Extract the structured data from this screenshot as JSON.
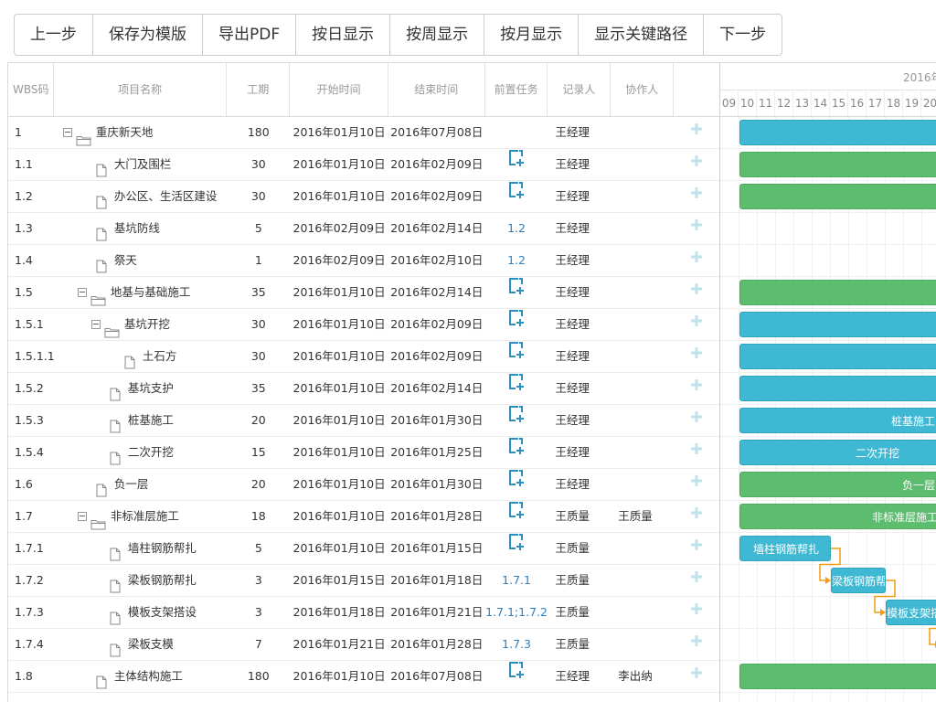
{
  "toolbar": {
    "prev": "上一步",
    "save_template": "保存为模版",
    "export_pdf": "导出PDF",
    "by_day": "按日显示",
    "by_week": "按周显示",
    "by_month": "按月显示",
    "critical_path": "显示关键路径",
    "next": "下一步"
  },
  "columns": {
    "wbs": "WBS码",
    "name": "项目名称",
    "duration": "工期",
    "start": "开始时间",
    "end": "结束时间",
    "predecessor": "前置任务",
    "recorder": "记录人",
    "collaborator": "协作人"
  },
  "gantt": {
    "month_label": "2016年",
    "days": [
      "09",
      "10",
      "11",
      "12",
      "13",
      "14",
      "15",
      "16",
      "17",
      "18",
      "19",
      "20"
    ]
  },
  "colors": {
    "blue_bar": "#3fb8d4",
    "green_bar": "#5cbd6e",
    "link": "#f39c12",
    "accent": "#2f7fc1"
  },
  "rows": [
    {
      "wbs": "1",
      "name": "重庆新天地",
      "level": 0,
      "type": "folder",
      "duration": "180",
      "start": "2016年01月10日",
      "end": "2016年07月08日",
      "pred": "",
      "pred_icon": false,
      "recorder": "王经理",
      "collab": "",
      "bar": "blue",
      "bar_label": ""
    },
    {
      "wbs": "1.1",
      "name": "大门及围栏",
      "level": 1,
      "type": "file",
      "duration": "30",
      "start": "2016年01月10日",
      "end": "2016年02月09日",
      "pred": "",
      "pred_icon": true,
      "recorder": "王经理",
      "collab": "",
      "bar": "green",
      "bar_label": ""
    },
    {
      "wbs": "1.2",
      "name": "办公区、生活区建设",
      "level": 1,
      "type": "file",
      "duration": "30",
      "start": "2016年01月10日",
      "end": "2016年02月09日",
      "pred": "",
      "pred_icon": true,
      "recorder": "王经理",
      "collab": "",
      "bar": "green",
      "bar_label": ""
    },
    {
      "wbs": "1.3",
      "name": "基坑防线",
      "level": 1,
      "type": "file",
      "duration": "5",
      "start": "2016年02月09日",
      "end": "2016年02月14日",
      "pred": "1.2",
      "pred_icon": false,
      "recorder": "王经理",
      "collab": "",
      "bar": "",
      "bar_label": ""
    },
    {
      "wbs": "1.4",
      "name": "祭天",
      "level": 1,
      "type": "file",
      "duration": "1",
      "start": "2016年02月09日",
      "end": "2016年02月10日",
      "pred": "1.2",
      "pred_icon": false,
      "recorder": "王经理",
      "collab": "",
      "bar": "",
      "bar_label": ""
    },
    {
      "wbs": "1.5",
      "name": "地基与基础施工",
      "level": 1,
      "type": "folder",
      "duration": "35",
      "start": "2016年01月10日",
      "end": "2016年02月14日",
      "pred": "",
      "pred_icon": true,
      "recorder": "王经理",
      "collab": "",
      "bar": "green",
      "bar_label": ""
    },
    {
      "wbs": "1.5.1",
      "name": "基坑开挖",
      "level": 2,
      "type": "folder",
      "duration": "30",
      "start": "2016年01月10日",
      "end": "2016年02月09日",
      "pred": "",
      "pred_icon": true,
      "recorder": "王经理",
      "collab": "",
      "bar": "blue",
      "bar_label": ""
    },
    {
      "wbs": "1.5.1.1",
      "name": "土石方",
      "level": 3,
      "type": "file",
      "duration": "30",
      "start": "2016年01月10日",
      "end": "2016年02月09日",
      "pred": "",
      "pred_icon": true,
      "recorder": "王经理",
      "collab": "",
      "bar": "blue",
      "bar_label": ""
    },
    {
      "wbs": "1.5.2",
      "name": "基坑支护",
      "level": 2,
      "type": "file",
      "duration": "35",
      "start": "2016年01月10日",
      "end": "2016年02月14日",
      "pred": "",
      "pred_icon": true,
      "recorder": "王经理",
      "collab": "",
      "bar": "blue",
      "bar_label": ""
    },
    {
      "wbs": "1.5.3",
      "name": "桩基施工",
      "level": 2,
      "type": "file",
      "duration": "20",
      "start": "2016年01月10日",
      "end": "2016年01月30日",
      "pred": "",
      "pred_icon": true,
      "recorder": "王经理",
      "collab": "",
      "bar": "blue",
      "bar_label": "桩基施工"
    },
    {
      "wbs": "1.5.4",
      "name": "二次开挖",
      "level": 2,
      "type": "file",
      "duration": "15",
      "start": "2016年01月10日",
      "end": "2016年01月25日",
      "pred": "",
      "pred_icon": true,
      "recorder": "王经理",
      "collab": "",
      "bar": "blue",
      "bar_label": "二次开挖"
    },
    {
      "wbs": "1.6",
      "name": "负一层",
      "level": 1,
      "type": "file",
      "duration": "20",
      "start": "2016年01月10日",
      "end": "2016年01月30日",
      "pred": "",
      "pred_icon": true,
      "recorder": "王经理",
      "collab": "",
      "bar": "green",
      "bar_label": "负一层"
    },
    {
      "wbs": "1.7",
      "name": "非标准层施工",
      "level": 1,
      "type": "folder",
      "duration": "18",
      "start": "2016年01月10日",
      "end": "2016年01月28日",
      "pred": "",
      "pred_icon": true,
      "recorder": "王质量",
      "collab": "王质量",
      "bar": "green",
      "bar_label": "非标准层施工"
    },
    {
      "wbs": "1.7.1",
      "name": "墙柱钢筋帮扎",
      "level": 2,
      "type": "file",
      "duration": "5",
      "start": "2016年01月10日",
      "end": "2016年01月15日",
      "pred": "",
      "pred_icon": true,
      "recorder": "王质量",
      "collab": "",
      "bar": "blue",
      "bar_label": "墙柱钢筋帮扎"
    },
    {
      "wbs": "1.7.2",
      "name": "梁板钢筋帮扎",
      "level": 2,
      "type": "file",
      "duration": "3",
      "start": "2016年01月15日",
      "end": "2016年01月18日",
      "pred": "1.7.1",
      "pred_icon": false,
      "recorder": "王质量",
      "collab": "",
      "bar": "blue",
      "bar_label": "梁板钢筋帮"
    },
    {
      "wbs": "1.7.3",
      "name": "模板支架搭设",
      "level": 2,
      "type": "file",
      "duration": "3",
      "start": "2016年01月18日",
      "end": "2016年01月21日",
      "pred": "1.7.1;1.7.2",
      "pred_icon": false,
      "recorder": "王质量",
      "collab": "",
      "bar": "blue",
      "bar_label": "模板支架搭"
    },
    {
      "wbs": "1.7.4",
      "name": "梁板支模",
      "level": 2,
      "type": "file",
      "duration": "7",
      "start": "2016年01月21日",
      "end": "2016年01月28日",
      "pred": "1.7.3",
      "pred_icon": false,
      "recorder": "王质量",
      "collab": "",
      "bar": "blue",
      "bar_label": ""
    },
    {
      "wbs": "1.8",
      "name": "主体结构施工",
      "level": 1,
      "type": "file",
      "duration": "180",
      "start": "2016年01月10日",
      "end": "2016年07月08日",
      "pred": "",
      "pred_icon": true,
      "recorder": "王经理",
      "collab": "李出纳",
      "bar": "green",
      "bar_label": ""
    }
  ]
}
